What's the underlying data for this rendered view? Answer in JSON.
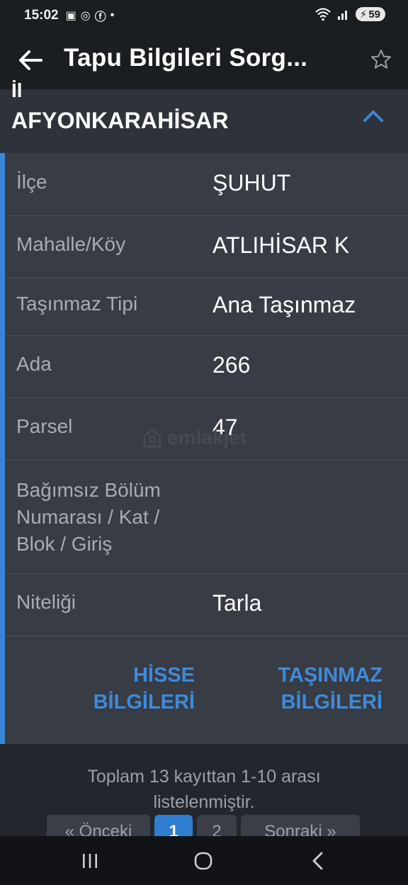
{
  "status_bar": {
    "time": "15:02",
    "left_icons": [
      "gallery-icon",
      "whatsapp-icon",
      "facebook-icon",
      "dot-icon"
    ],
    "battery": "59"
  },
  "app_bar": {
    "title": "Tapu Bilgileri Sorg..."
  },
  "section": {
    "label": "İl",
    "city": "AFYONKARAHİSAR"
  },
  "fields": [
    {
      "label": "İlçe",
      "value": "ŞUHUT"
    },
    {
      "label": "Mahalle/Köy",
      "value": "ATLIHİSAR K"
    },
    {
      "label": "Taşınmaz Tipi",
      "value": "Ana Taşınmaz"
    },
    {
      "label": "Ada",
      "value": "266"
    },
    {
      "label": "Parsel",
      "value": "47"
    },
    {
      "label": "Bağımsız Bölüm Numarası / Kat / Blok / Giriş",
      "value": ""
    },
    {
      "label": "Niteliği",
      "value": "Tarla"
    }
  ],
  "actions": {
    "hisse": "HİSSE BİLGİLERİ",
    "tasinmaz": "TAŞINMAZ BİLGİLERİ"
  },
  "footer": {
    "info": "Toplam 13 kayıttan 1-10 arası listelenmiştir."
  },
  "pagination": {
    "prev": "« Önceki",
    "pages": [
      "1",
      "2"
    ],
    "next": "Sonraki »"
  },
  "watermark": "emlakjet",
  "colors": {
    "accent": "#3a86d6",
    "link": "#3f8ad8",
    "card": "#373c45",
    "header": "#2e333b"
  }
}
